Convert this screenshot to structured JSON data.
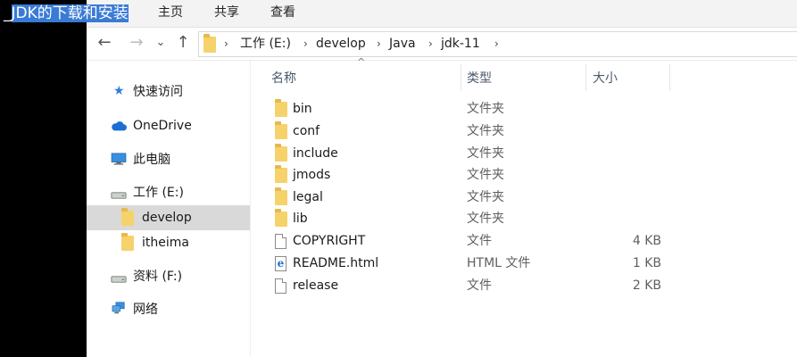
{
  "overlay_title": {
    "text_a": "_",
    "text_b": "JDK的下载和安装"
  },
  "ribbon": {
    "tabs": [
      "主页",
      "共享",
      "查看"
    ]
  },
  "nav": {
    "back": "←",
    "forward": "→",
    "recent": "⌄",
    "up": "↑"
  },
  "address": {
    "crumbs": [
      "工作 (E:)",
      "develop",
      "Java",
      "jdk-11"
    ],
    "separator": "›"
  },
  "navpane": {
    "items": [
      {
        "label": "快速访问",
        "icon": "star-icon"
      },
      {
        "label": "OneDrive",
        "icon": "cloud-icon"
      },
      {
        "label": "此电脑",
        "icon": "computer-icon"
      },
      {
        "label": "工作 (E:)",
        "icon": "drive-icon"
      },
      {
        "label": "develop",
        "icon": "folder-icon",
        "selected": true
      },
      {
        "label": "itheima",
        "icon": "folder-icon"
      },
      {
        "label": "资料 (F:)",
        "icon": "drive-icon"
      },
      {
        "label": "网络",
        "icon": "network-icon"
      }
    ]
  },
  "columns": {
    "name": "名称",
    "type": "类型",
    "size": "大小",
    "sort_indicator": "^"
  },
  "files": [
    {
      "name": "bin",
      "type": "文件夹",
      "size": "",
      "icon": "folder-icon"
    },
    {
      "name": "conf",
      "type": "文件夹",
      "size": "",
      "icon": "folder-icon"
    },
    {
      "name": "include",
      "type": "文件夹",
      "size": "",
      "icon": "folder-icon"
    },
    {
      "name": "jmods",
      "type": "文件夹",
      "size": "",
      "icon": "folder-icon"
    },
    {
      "name": "legal",
      "type": "文件夹",
      "size": "",
      "icon": "folder-icon"
    },
    {
      "name": "lib",
      "type": "文件夹",
      "size": "",
      "icon": "folder-icon"
    },
    {
      "name": "COPYRIGHT",
      "type": "文件",
      "size": "4 KB",
      "icon": "file-icon"
    },
    {
      "name": "README.html",
      "type": "HTML 文件",
      "size": "1 KB",
      "icon": "html-file-icon"
    },
    {
      "name": "release",
      "type": "文件",
      "size": "2 KB",
      "icon": "file-icon"
    }
  ],
  "colors": {
    "selected_bg": "#d9d9d9",
    "folder": "#f6d26b",
    "highlight": "#3a7bd5"
  }
}
